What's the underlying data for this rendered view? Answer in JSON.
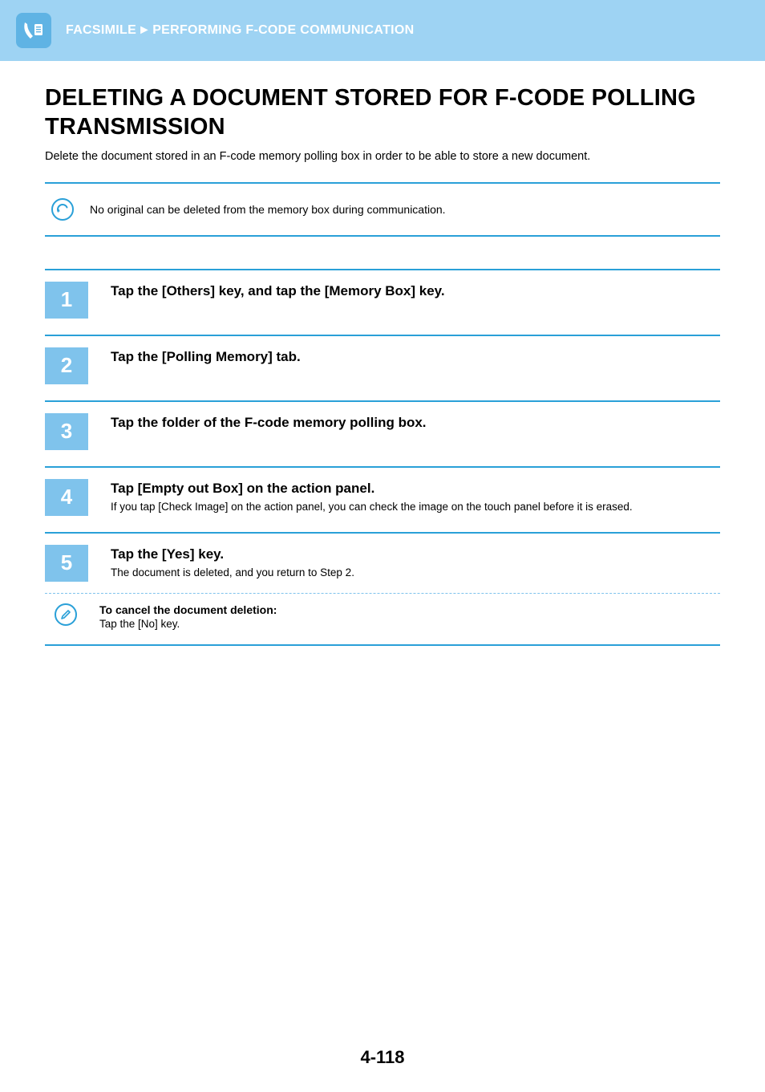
{
  "breadcrumb": {
    "section": "FACSIMILE",
    "subsection": "PERFORMING F-CODE COMMUNICATION"
  },
  "title": "DELETING A DOCUMENT STORED FOR F-CODE POLLING TRANSMISSION",
  "intro": "Delete the document stored in an F-code memory polling box in order to be able to store a new document.",
  "note": "No original can be deleted from the memory box during communication.",
  "steps": [
    {
      "num": "1",
      "title": "Tap the [Others] key, and tap the [Memory Box] key.",
      "desc": ""
    },
    {
      "num": "2",
      "title": "Tap the [Polling Memory] tab.",
      "desc": ""
    },
    {
      "num": "3",
      "title": "Tap the folder of the F-code memory polling box.",
      "desc": ""
    },
    {
      "num": "4",
      "title": "Tap [Empty out Box] on the action panel.",
      "desc": "If you tap [Check Image] on the action panel, you can check the image on the touch panel before it is erased."
    },
    {
      "num": "5",
      "title": "Tap the [Yes] key.",
      "desc": "The document is deleted, and you return to Step 2."
    }
  ],
  "cancel": {
    "title": "To cancel the document deletion:",
    "text": "Tap the [No] key."
  },
  "page_number": "4-118"
}
